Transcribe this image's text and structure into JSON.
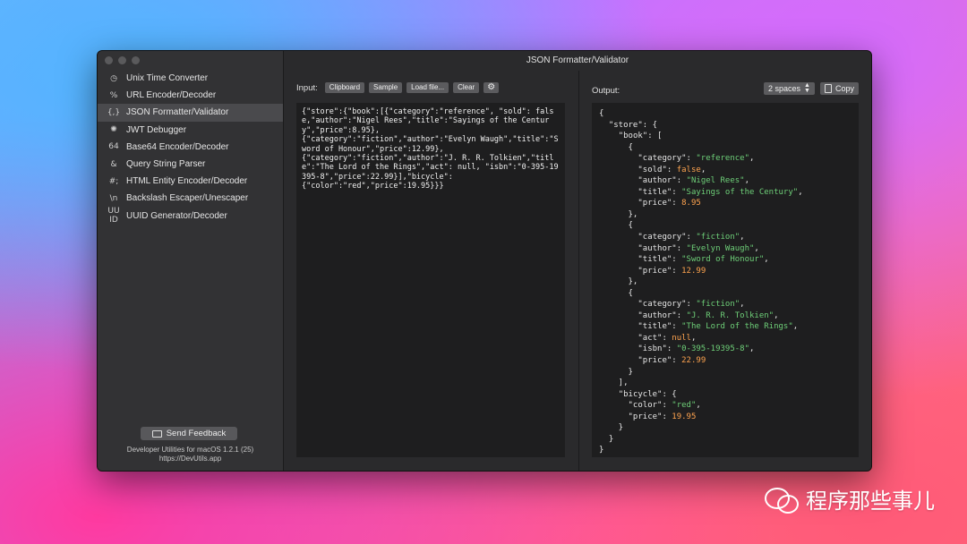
{
  "window": {
    "title": "JSON Formatter/Validator"
  },
  "sidebar": {
    "items": [
      {
        "icon": "◷",
        "icon_name": "clock-icon",
        "label": "Unix Time Converter"
      },
      {
        "icon": "%",
        "icon_name": "percent-icon",
        "label": "URL Encoder/Decoder"
      },
      {
        "icon": "{,}",
        "icon_name": "braces-icon",
        "label": "JSON Formatter/Validator"
      },
      {
        "icon": "✺",
        "icon_name": "jwt-icon",
        "label": "JWT Debugger"
      },
      {
        "icon": "64",
        "icon_name": "base64-icon",
        "label": "Base64 Encoder/Decoder"
      },
      {
        "icon": "&",
        "icon_name": "ampersand-icon",
        "label": "Query String Parser"
      },
      {
        "icon": "#;",
        "icon_name": "hash-icon",
        "label": "HTML Entity Encoder/Decoder"
      },
      {
        "icon": "\\n",
        "icon_name": "backslash-icon",
        "label": "Backslash Escaper/Unescaper"
      },
      {
        "icon": "UU ID",
        "icon_name": "uuid-icon",
        "label": "UUID Generator/Decoder"
      }
    ],
    "active_index": 2,
    "feedback_label": "Send Feedback",
    "version": "Developer Utilities for macOS 1.2.1 (25)",
    "url": "https://DevUtils.app"
  },
  "input": {
    "label": "Input:",
    "buttons": [
      "Clipboard",
      "Sample",
      "Load file...",
      "Clear"
    ],
    "settings_icon": "gear-icon",
    "text": "{\"store\":{\"book\":[{\"category\":\"reference\", \"sold\": false,\"author\":\"Nigel Rees\",\"title\":\"Sayings of the Century\",\"price\":8.95},\n{\"category\":\"fiction\",\"author\":\"Evelyn Waugh\",\"title\":\"Sword of Honour\",\"price\":12.99},\n{\"category\":\"fiction\",\"author\":\"J. R. R. Tolkien\",\"title\":\"The Lord of the Rings\",\"act\": null, \"isbn\":\"0-395-19395-8\",\"price\":22.99}],\"bicycle\":\n{\"color\":\"red\",\"price\":19.95}}}"
  },
  "output": {
    "label": "Output:",
    "indent_option": "2 spaces",
    "copy_label": "Copy",
    "lines": [
      [
        [
          "p",
          "{"
        ]
      ],
      [
        [
          "p",
          "  "
        ],
        [
          "k",
          "\"store\""
        ],
        [
          "p",
          ": {"
        ]
      ],
      [
        [
          "p",
          "    "
        ],
        [
          "k",
          "\"book\""
        ],
        [
          "p",
          ": ["
        ]
      ],
      [
        [
          "p",
          "      {"
        ]
      ],
      [
        [
          "p",
          "        "
        ],
        [
          "k",
          "\"category\""
        ],
        [
          "p",
          ": "
        ],
        [
          "s",
          "\"reference\""
        ],
        [
          "p",
          ","
        ]
      ],
      [
        [
          "p",
          "        "
        ],
        [
          "k",
          "\"sold\""
        ],
        [
          "p",
          ": "
        ],
        [
          "n",
          "false"
        ],
        [
          "p",
          ","
        ]
      ],
      [
        [
          "p",
          "        "
        ],
        [
          "k",
          "\"author\""
        ],
        [
          "p",
          ": "
        ],
        [
          "s",
          "\"Nigel Rees\""
        ],
        [
          "p",
          ","
        ]
      ],
      [
        [
          "p",
          "        "
        ],
        [
          "k",
          "\"title\""
        ],
        [
          "p",
          ": "
        ],
        [
          "s",
          "\"Sayings of the Century\""
        ],
        [
          "p",
          ","
        ]
      ],
      [
        [
          "p",
          "        "
        ],
        [
          "k",
          "\"price\""
        ],
        [
          "p",
          ": "
        ],
        [
          "n",
          "8.95"
        ]
      ],
      [
        [
          "p",
          "      },"
        ]
      ],
      [
        [
          "p",
          "      {"
        ]
      ],
      [
        [
          "p",
          "        "
        ],
        [
          "k",
          "\"category\""
        ],
        [
          "p",
          ": "
        ],
        [
          "s",
          "\"fiction\""
        ],
        [
          "p",
          ","
        ]
      ],
      [
        [
          "p",
          "        "
        ],
        [
          "k",
          "\"author\""
        ],
        [
          "p",
          ": "
        ],
        [
          "s",
          "\"Evelyn Waugh\""
        ],
        [
          "p",
          ","
        ]
      ],
      [
        [
          "p",
          "        "
        ],
        [
          "k",
          "\"title\""
        ],
        [
          "p",
          ": "
        ],
        [
          "s",
          "\"Sword of Honour\""
        ],
        [
          "p",
          ","
        ]
      ],
      [
        [
          "p",
          "        "
        ],
        [
          "k",
          "\"price\""
        ],
        [
          "p",
          ": "
        ],
        [
          "n",
          "12.99"
        ]
      ],
      [
        [
          "p",
          "      },"
        ]
      ],
      [
        [
          "p",
          "      {"
        ]
      ],
      [
        [
          "p",
          "        "
        ],
        [
          "k",
          "\"category\""
        ],
        [
          "p",
          ": "
        ],
        [
          "s",
          "\"fiction\""
        ],
        [
          "p",
          ","
        ]
      ],
      [
        [
          "p",
          "        "
        ],
        [
          "k",
          "\"author\""
        ],
        [
          "p",
          ": "
        ],
        [
          "s",
          "\"J. R. R. Tolkien\""
        ],
        [
          "p",
          ","
        ]
      ],
      [
        [
          "p",
          "        "
        ],
        [
          "k",
          "\"title\""
        ],
        [
          "p",
          ": "
        ],
        [
          "s",
          "\"The Lord of the Rings\""
        ],
        [
          "p",
          ","
        ]
      ],
      [
        [
          "p",
          "        "
        ],
        [
          "k",
          "\"act\""
        ],
        [
          "p",
          ": "
        ],
        [
          "n",
          "null"
        ],
        [
          "p",
          ","
        ]
      ],
      [
        [
          "p",
          "        "
        ],
        [
          "k",
          "\"isbn\""
        ],
        [
          "p",
          ": "
        ],
        [
          "s",
          "\"0-395-19395-8\""
        ],
        [
          "p",
          ","
        ]
      ],
      [
        [
          "p",
          "        "
        ],
        [
          "k",
          "\"price\""
        ],
        [
          "p",
          ": "
        ],
        [
          "n",
          "22.99"
        ]
      ],
      [
        [
          "p",
          "      }"
        ]
      ],
      [
        [
          "p",
          "    ],"
        ]
      ],
      [
        [
          "p",
          "    "
        ],
        [
          "k",
          "\"bicycle\""
        ],
        [
          "p",
          ": {"
        ]
      ],
      [
        [
          "p",
          "      "
        ],
        [
          "k",
          "\"color\""
        ],
        [
          "p",
          ": "
        ],
        [
          "s",
          "\"red\""
        ],
        [
          "p",
          ","
        ]
      ],
      [
        [
          "p",
          "      "
        ],
        [
          "k",
          "\"price\""
        ],
        [
          "p",
          ": "
        ],
        [
          "n",
          "19.95"
        ]
      ],
      [
        [
          "p",
          "    }"
        ]
      ],
      [
        [
          "p",
          "  }"
        ]
      ],
      [
        [
          "p",
          "}"
        ]
      ]
    ]
  },
  "watermark": {
    "text": "程序那些事儿",
    "icon": "wechat-icon"
  }
}
